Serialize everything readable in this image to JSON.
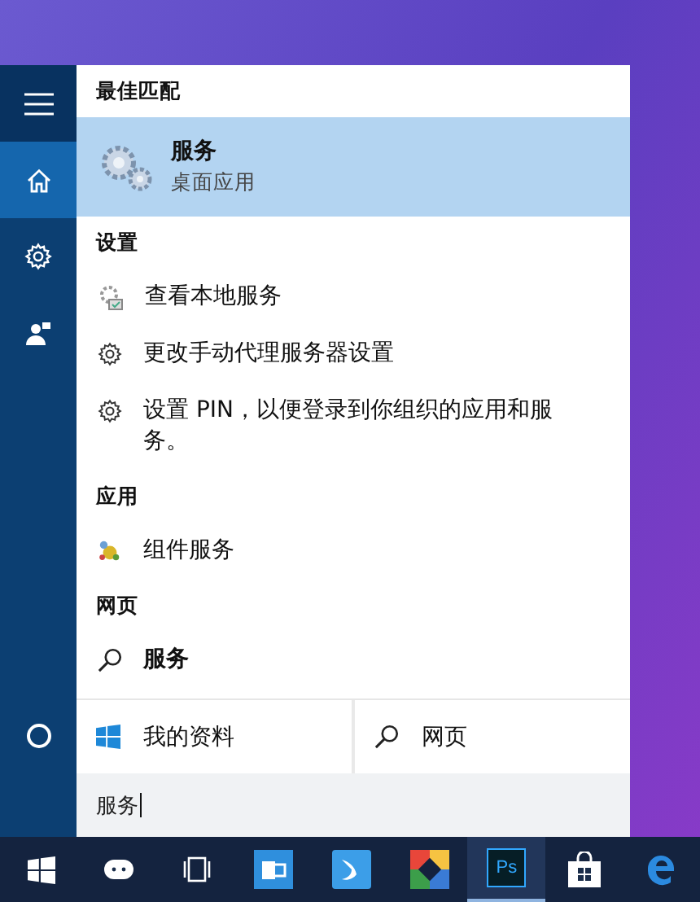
{
  "sidebar": {
    "items": [
      {
        "kind": "menu",
        "selected": false
      },
      {
        "kind": "home",
        "selected": true
      },
      {
        "kind": "settings",
        "selected": false
      },
      {
        "kind": "feedback",
        "selected": false
      }
    ],
    "bottom": [
      {
        "kind": "cortana",
        "selected": false
      }
    ]
  },
  "best_match": {
    "heading": "最佳匹配",
    "title": "服务",
    "subtitle": "桌面应用",
    "selected": true
  },
  "sections": [
    {
      "heading": "设置",
      "items": [
        {
          "kind": "services",
          "label": "查看本地服务",
          "bold": false
        },
        {
          "kind": "gear",
          "label": "更改手动代理服务器设置",
          "bold": false
        },
        {
          "kind": "gear",
          "label": "设置 PIN，以便登录到你组织的应用和服务。",
          "bold": false
        }
      ]
    },
    {
      "heading": "应用",
      "items": [
        {
          "kind": "component",
          "label": "组件服务",
          "bold": false
        }
      ]
    },
    {
      "heading": "网页",
      "items": [
        {
          "kind": "search",
          "label": "服务",
          "bold": true
        }
      ]
    }
  ],
  "scopes": [
    {
      "kind": "windows",
      "label": "我的资料"
    },
    {
      "kind": "search",
      "label": "网页"
    }
  ],
  "search": {
    "value": "服务"
  },
  "taskbar": {
    "items": [
      {
        "kind": "start",
        "active": false
      },
      {
        "kind": "cortana",
        "active": false
      },
      {
        "kind": "taskview",
        "active": false
      },
      {
        "kind": "outlook",
        "active": false
      },
      {
        "kind": "bird",
        "active": false
      },
      {
        "kind": "colors",
        "active": false
      },
      {
        "kind": "photoshop",
        "label": "Ps",
        "active": true
      },
      {
        "kind": "store",
        "active": false
      },
      {
        "kind": "edge",
        "active": false
      }
    ]
  }
}
